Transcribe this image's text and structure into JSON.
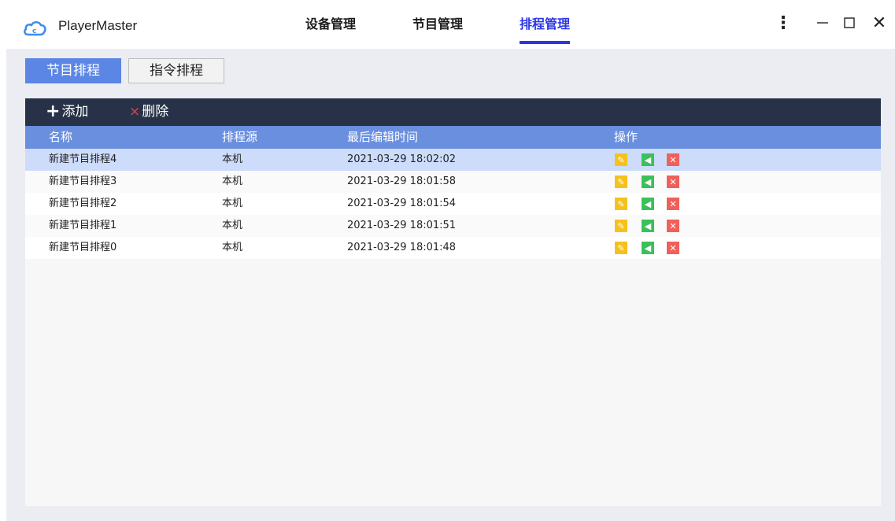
{
  "app": {
    "name": "PlayerMaster"
  },
  "nav": {
    "device": "设备管理",
    "program": "节目管理",
    "schedule": "排程管理"
  },
  "window_controls": {
    "more": "⋮",
    "close": "✕"
  },
  "sub_tabs": {
    "program_schedule": "节目排程",
    "command_schedule": "指令排程"
  },
  "toolbar": {
    "add_icon": "+",
    "add": "添加",
    "delete_icon": "×",
    "delete": "删除"
  },
  "table": {
    "headers": {
      "name": "名称",
      "source": "排程源",
      "modified": "最后编辑时间",
      "ops": "操作"
    },
    "rows": [
      {
        "name": "新建节目排程4",
        "source": "本机",
        "modified": "2021-03-29 18:02:02"
      },
      {
        "name": "新建节目排程3",
        "source": "本机",
        "modified": "2021-03-29 18:01:58"
      },
      {
        "name": "新建节目排程2",
        "source": "本机",
        "modified": "2021-03-29 18:01:54"
      },
      {
        "name": "新建节目排程1",
        "source": "本机",
        "modified": "2021-03-29 18:01:51"
      },
      {
        "name": "新建节目排程0",
        "source": "本机",
        "modified": "2021-03-29 18:01:48"
      }
    ]
  },
  "colors": {
    "accent": "#2c36e6",
    "toolbar": "#273248",
    "header": "#6a8fdf",
    "selected_row": "#cddcfb",
    "edit": "#f5c21b",
    "send": "#3cc05a",
    "delete": "#f0605a"
  },
  "icons": {
    "logo": "cloud-logo-icon",
    "edit": "edit-icon",
    "send": "send-icon",
    "delete": "delete-icon"
  }
}
